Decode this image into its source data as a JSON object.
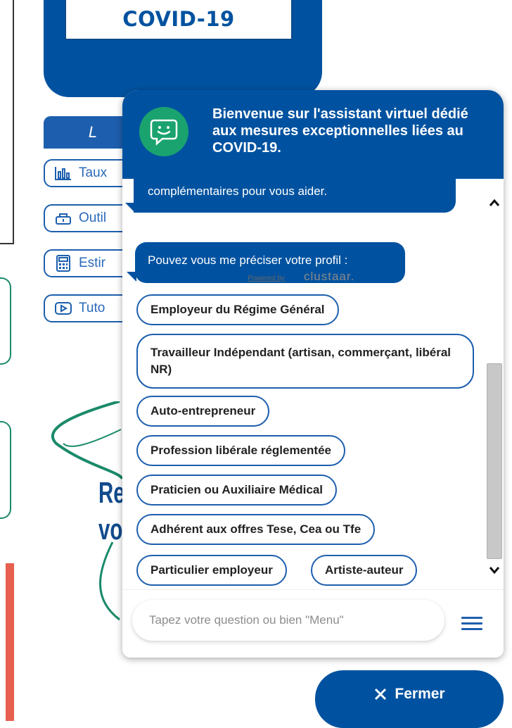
{
  "page": {
    "covid_title": "COVID-19",
    "links_header": "L",
    "links": [
      {
        "label": "Taux",
        "icon": "bar-chart-icon"
      },
      {
        "label": "Outil",
        "icon": "tools-icon"
      },
      {
        "label": "Estir",
        "icon": "calculator-icon"
      },
      {
        "label": "Tuto",
        "icon": "play-icon"
      }
    ],
    "logo_text_line1": "Re",
    "logo_text_line2": "vo"
  },
  "chat": {
    "title": "Bienvenue sur l'assistant virtuel dédié aux mesures exceptionnelles liées au COVID-19.",
    "prev_message": "complémentaires pour vous aider.",
    "question": "Pouvez vous me préciser votre profil :",
    "powered_by": "Powered by",
    "powered_brand": "clustaar.",
    "choices": [
      "Employeur du Régime Général",
      "Travailleur Indépendant (artisan, commerçant, libéral NR)",
      "Auto-entrepreneur",
      "Profession libérale réglementée",
      "Praticien ou Auxiliaire Médical",
      "Adhérent aux offres Tese, Cea ou Tfe",
      "Particulier employeur",
      "Artiste-auteur"
    ],
    "input_placeholder": "Tapez votre question ou bien \"Menu\"",
    "close_label": "Fermer"
  },
  "colors": {
    "primary_blue": "#0052a0",
    "avatar_green": "#1aa36e",
    "accent_red": "#e75f4e"
  }
}
